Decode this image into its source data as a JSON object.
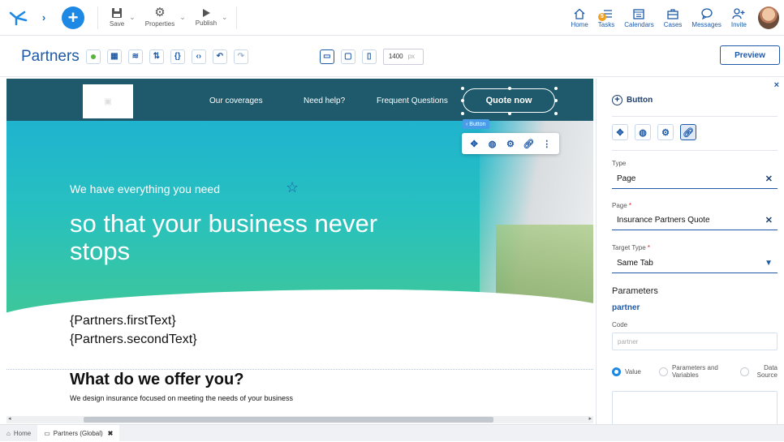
{
  "toolbar": {
    "save_label": "Save",
    "properties_label": "Properties",
    "publish_label": "Publish"
  },
  "right_nav": {
    "home_label": "Home",
    "tasks_label": "Tasks",
    "tasks_badge": "5",
    "calendars_label": "Calendars",
    "cases_label": "Cases",
    "messages_label": "Messages",
    "invite_label": "Invite"
  },
  "subbar": {
    "page_title": "Partners",
    "width_value": "1400",
    "width_unit": "px",
    "preview_label": "Preview"
  },
  "site": {
    "nav_links": [
      "Our coverages",
      "Need help?",
      "Frequent Questions"
    ],
    "quote_button": "Quote now",
    "selection_label": "‹ Button",
    "hero_sub": "We have everything you need",
    "hero_title": "so that your business never stops",
    "var_first": "{Partners.firstText}",
    "var_second": "{Partners.secondText}",
    "section_title": "What do we offer you?",
    "section_text": "We design insurance focused on meeting the needs of your business"
  },
  "panel": {
    "title": "Button",
    "type_label": "Type",
    "type_value": "Page",
    "page_label": "Page",
    "page_value": "Insurance Partners Quote",
    "target_label": "Target Type",
    "target_value": "Same Tab",
    "parameters_label": "Parameters",
    "param_name": "partner",
    "code_label": "Code",
    "code_placeholder": "partner",
    "radio_value": "Value",
    "radio_params": "Parameters and Variables",
    "radio_datasource": "Data Source"
  },
  "bottom_tabs": {
    "home": "Home",
    "partners": "Partners (Global)"
  },
  "colors": {
    "accent": "#1e5aa8",
    "add_button": "#1e88e5",
    "site_nav": "#1e5a6b",
    "hero_top": "#1fb3cf",
    "hero_bottom": "#3ec79a"
  }
}
